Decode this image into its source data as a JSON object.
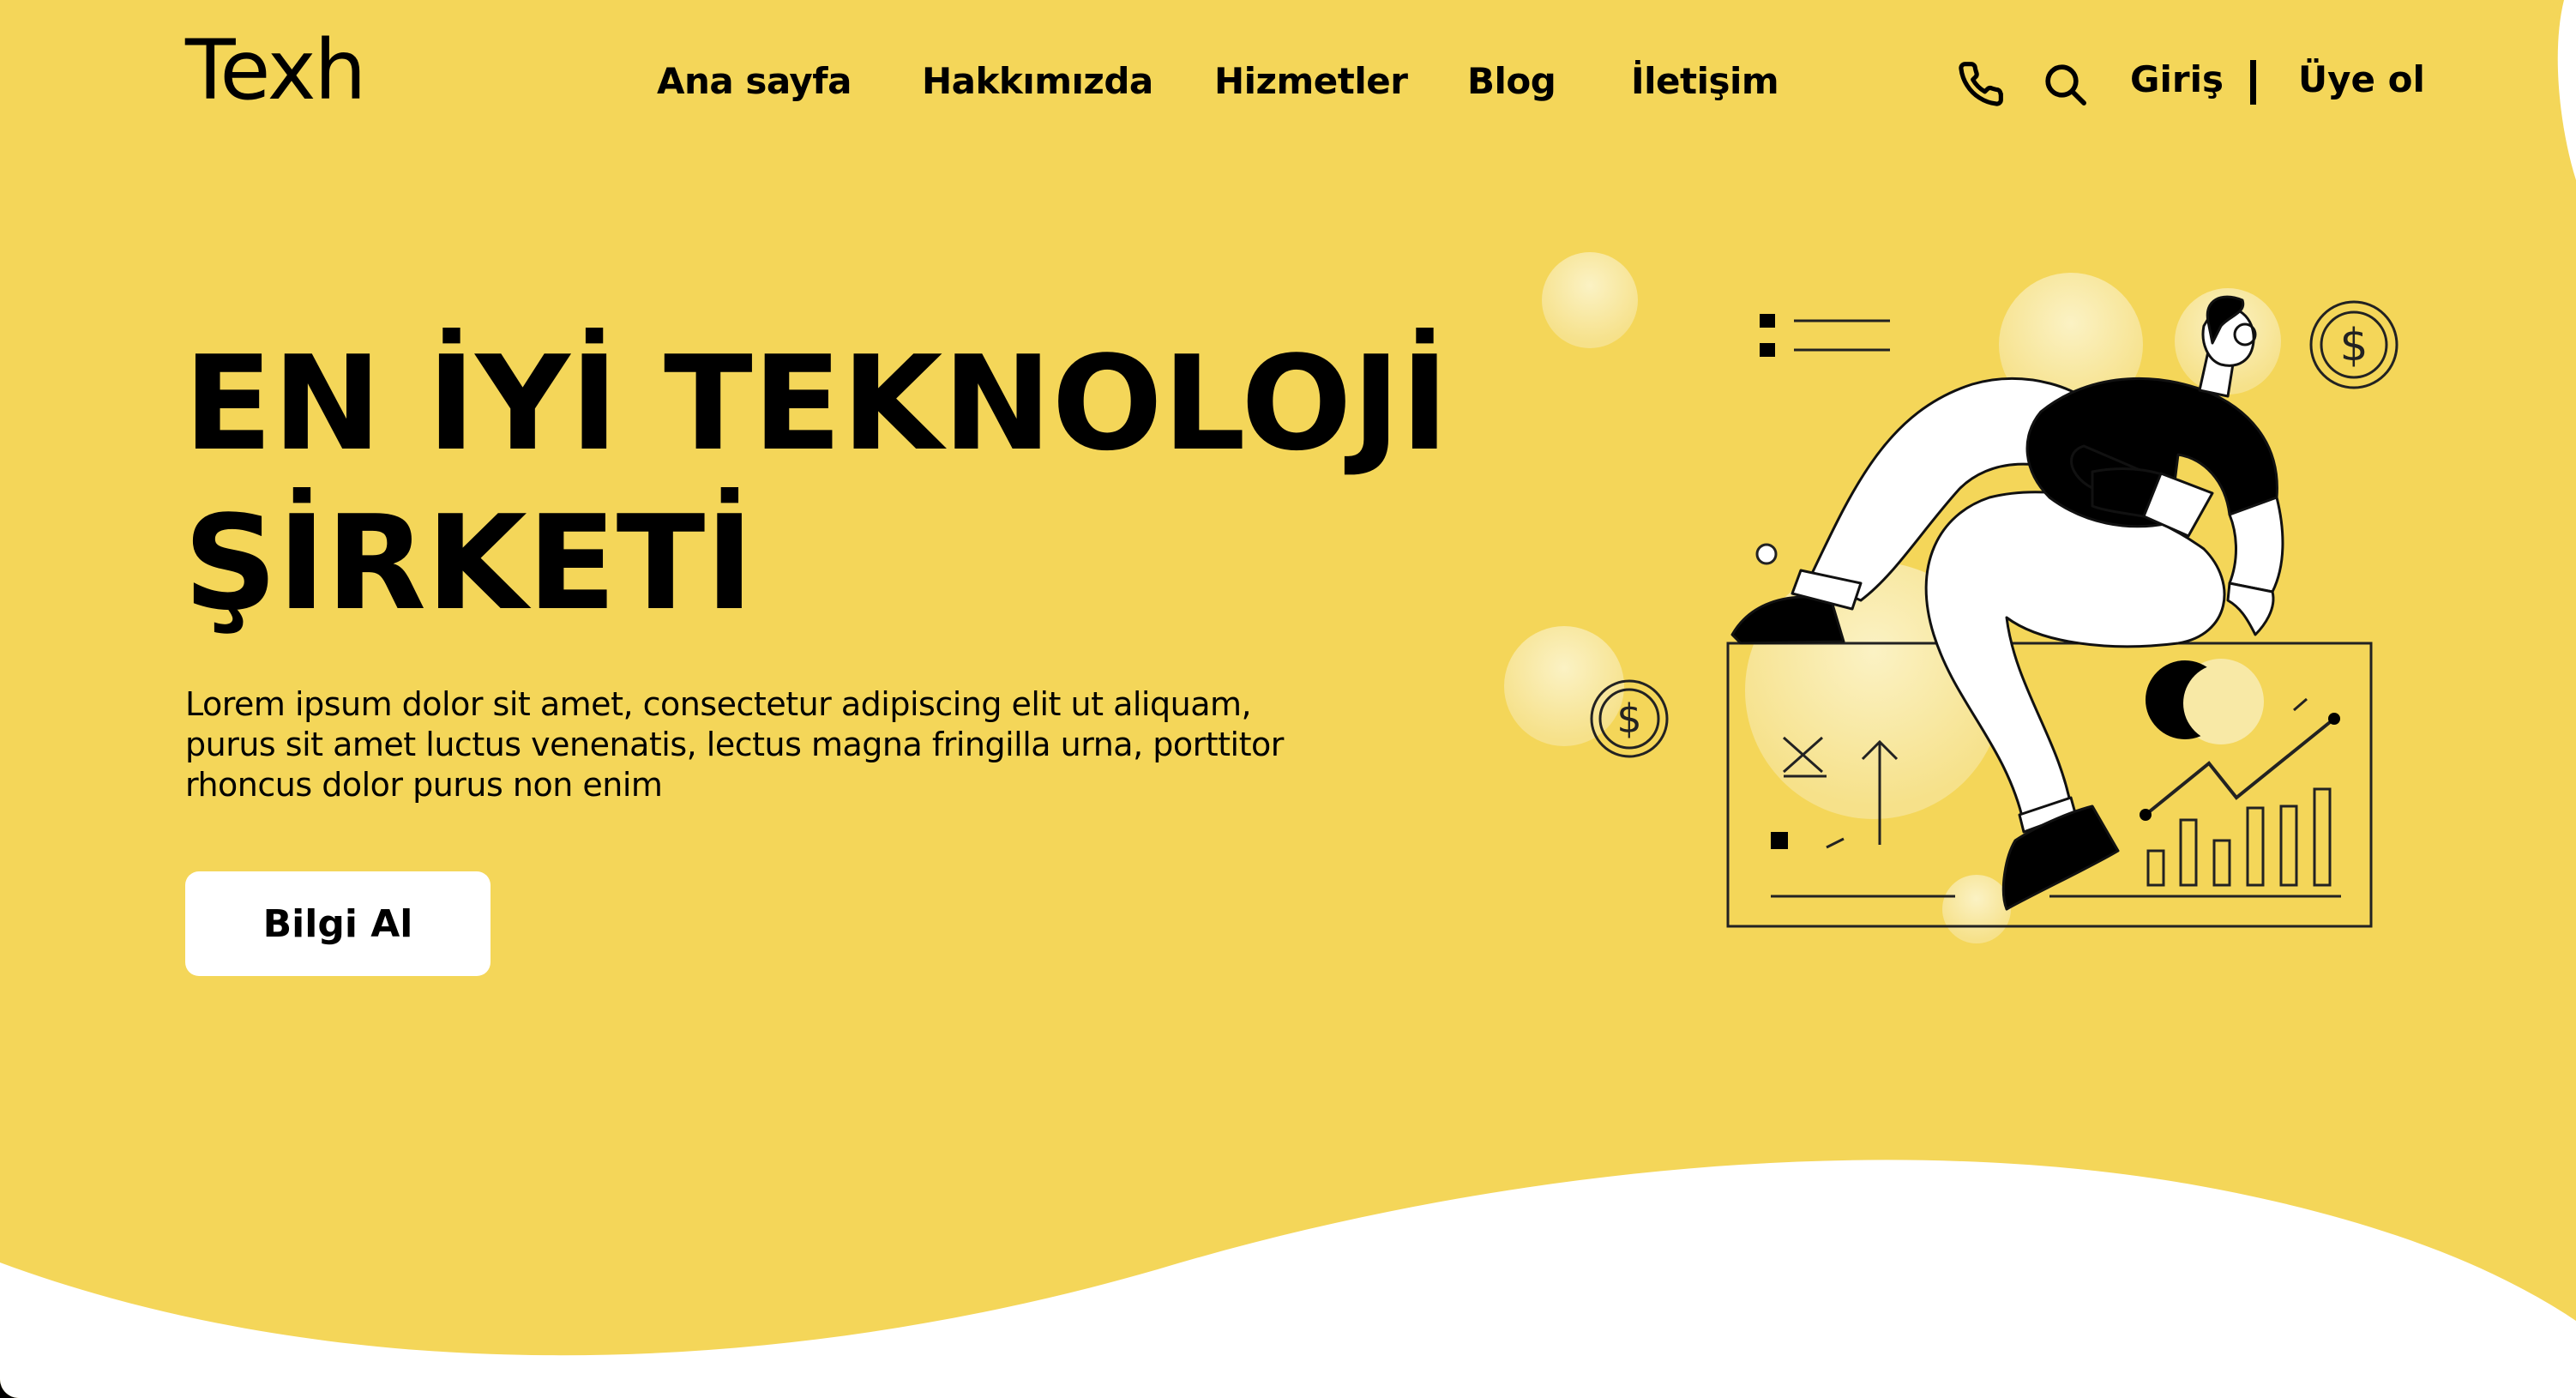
{
  "brand": {
    "logo": "Texh"
  },
  "nav": {
    "items": [
      {
        "label": "Ana sayfa"
      },
      {
        "label": "Hakkımızda"
      },
      {
        "label": "Hizmetler"
      },
      {
        "label": "Blog"
      },
      {
        "label": "İletişim"
      }
    ]
  },
  "header_actions": {
    "phone_icon": "phone-icon",
    "search_icon": "search-icon",
    "login_label": "Giriş",
    "signup_label": "Üye ol"
  },
  "hero": {
    "title_line1": "EN İYİ TEKNOLOJİ",
    "title_line2": "ŞİRKETİ",
    "description": "Lorem ipsum dolor sit amet, consectetur adipiscing elit ut aliquam, purus sit amet luctus venenatis, lectus magna fringilla urna, porttitor rhoncus dolor purus non enim",
    "cta_label": "Bilgi Al",
    "illustration": "man-sitting-on-finance-dashboard-illustration"
  },
  "colors": {
    "background": "#F4D659",
    "accent_light": "#F8E9A6",
    "text": "#000000",
    "button_bg": "#FFFFFF"
  }
}
